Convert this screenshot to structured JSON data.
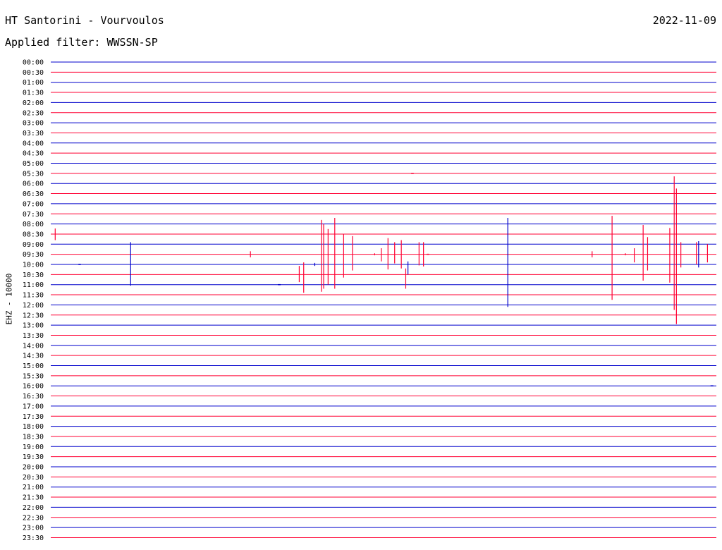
{
  "header": {
    "title": "HT Santorini - Vourvoulos",
    "date": "2022-11-09",
    "filter": "Applied filter: WWSSN-SP"
  },
  "channel_label": "EHZ - 10000",
  "colors": {
    "blue_trace": "#0000cc",
    "red_trace": "#ff0033",
    "background": "#ffffff",
    "text": "#000000"
  },
  "chart_data": {
    "type": "line",
    "subtype": "helicorder",
    "title": "HT Santorini - Vourvoulos",
    "subtitle": "Applied filter: WWSSN-SP",
    "ylabel": "EHZ - 10000",
    "xlim": [
      0,
      30
    ],
    "x_unit": "minutes",
    "row_colors": [
      "blue",
      "red"
    ],
    "rows": [
      "00:00",
      "00:30",
      "01:00",
      "01:30",
      "02:00",
      "02:30",
      "03:00",
      "03:30",
      "04:00",
      "04:30",
      "05:00",
      "05:30",
      "06:00",
      "06:30",
      "07:00",
      "07:30",
      "08:00",
      "08:30",
      "09:00",
      "09:30",
      "10:00",
      "10:30",
      "11:00",
      "11:30",
      "12:00",
      "12:30",
      "13:00",
      "13:30",
      "14:00",
      "14:30",
      "15:00",
      "15:30",
      "16:00",
      "16:30",
      "17:00",
      "17:30",
      "18:00",
      "18:30",
      "19:00",
      "19:30",
      "20:00",
      "20:30",
      "21:00",
      "21:30",
      "22:00",
      "22:30",
      "23:00",
      "23:30"
    ],
    "events": [
      {
        "row": "08:30",
        "minute": 0.2,
        "amp_up": 0.55,
        "amp_down": 0.6
      },
      {
        "row": "10:00",
        "minute": 1.3,
        "amp_up": 0.05,
        "amp_down": 0.05
      },
      {
        "row": "10:00",
        "minute": 3.6,
        "amp_up": 2.2,
        "amp_down": 2.1
      },
      {
        "row": "09:30",
        "minute": 9.0,
        "amp_up": 0.3,
        "amp_down": 0.3
      },
      {
        "row": "11:00",
        "minute": 10.3,
        "amp_up": 0.05,
        "amp_down": 0.05
      },
      {
        "row": "10:30",
        "minute": 11.2,
        "amp_up": 0.85,
        "amp_down": 0.75
      },
      {
        "row": "10:30",
        "minute": 11.4,
        "amp_up": 1.2,
        "amp_down": 1.8
      },
      {
        "row": "10:00",
        "minute": 11.9,
        "amp_up": 0.15,
        "amp_down": 0.15
      },
      {
        "row": "09:30",
        "minute": 12.2,
        "amp_up": 3.4,
        "amp_down": 3.7
      },
      {
        "row": "09:30",
        "minute": 12.3,
        "amp_up": 3.0,
        "amp_down": 3.4
      },
      {
        "row": "09:30",
        "minute": 12.5,
        "amp_up": 2.5,
        "amp_down": 3.0
      },
      {
        "row": "09:30",
        "minute": 12.8,
        "amp_up": 3.6,
        "amp_down": 3.4
      },
      {
        "row": "09:30",
        "minute": 13.2,
        "amp_up": 2.0,
        "amp_down": 2.3
      },
      {
        "row": "09:30",
        "minute": 13.6,
        "amp_up": 1.8,
        "amp_down": 1.6
      },
      {
        "row": "09:30",
        "minute": 14.6,
        "amp_up": 0.1,
        "amp_down": 0.1
      },
      {
        "row": "09:30",
        "minute": 14.9,
        "amp_up": 0.6,
        "amp_down": 0.7
      },
      {
        "row": "09:30",
        "minute": 15.2,
        "amp_up": 1.6,
        "amp_down": 1.5
      },
      {
        "row": "09:30",
        "minute": 15.5,
        "amp_up": 1.2,
        "amp_down": 0.9
      },
      {
        "row": "09:30",
        "minute": 15.8,
        "amp_up": 1.4,
        "amp_down": 1.4
      },
      {
        "row": "10:00",
        "minute": 16.1,
        "amp_up": 0.3,
        "amp_down": 1.0
      },
      {
        "row": "10:30",
        "minute": 16.0,
        "amp_up": 0.6,
        "amp_down": 1.4
      },
      {
        "row": "09:30",
        "minute": 16.6,
        "amp_up": 1.2,
        "amp_down": 1.1
      },
      {
        "row": "09:30",
        "minute": 16.8,
        "amp_up": 1.2,
        "amp_down": 1.2
      },
      {
        "row": "05:30",
        "minute": 16.3,
        "amp_up": 0.05,
        "amp_down": 0.05
      },
      {
        "row": "09:30",
        "minute": 17.0,
        "amp_up": 0.05,
        "amp_down": 0.05
      },
      {
        "row": "10:00",
        "minute": 20.6,
        "amp_up": 4.6,
        "amp_down": 4.2
      },
      {
        "row": "09:30",
        "minute": 24.4,
        "amp_up": 0.3,
        "amp_down": 0.3
      },
      {
        "row": "09:30",
        "minute": 25.3,
        "amp_up": 3.8,
        "amp_down": 4.5
      },
      {
        "row": "09:30",
        "minute": 25.9,
        "amp_up": 0.1,
        "amp_down": 0.1
      },
      {
        "row": "09:30",
        "minute": 26.3,
        "amp_up": 0.6,
        "amp_down": 0.8
      },
      {
        "row": "09:30",
        "minute": 26.7,
        "amp_up": 2.9,
        "amp_down": 2.6
      },
      {
        "row": "09:30",
        "minute": 26.9,
        "amp_up": 1.7,
        "amp_down": 1.6
      },
      {
        "row": "09:30",
        "minute": 27.9,
        "amp_up": 2.6,
        "amp_down": 2.8
      },
      {
        "row": "09:30",
        "minute": 28.1,
        "amp_up": 7.7,
        "amp_down": 5.5
      },
      {
        "row": "09:30",
        "minute": 28.2,
        "amp_up": 6.5,
        "amp_down": 6.9
      },
      {
        "row": "09:30",
        "minute": 28.4,
        "amp_up": 1.2,
        "amp_down": 1.3
      },
      {
        "row": "09:30",
        "minute": 29.1,
        "amp_up": 1.2,
        "amp_down": 1.0
      },
      {
        "row": "10:00",
        "minute": 29.2,
        "amp_up": 2.3,
        "amp_down": 0.3
      },
      {
        "row": "09:30",
        "minute": 29.6,
        "amp_up": 1.0,
        "amp_down": 0.8
      },
      {
        "row": "16:00",
        "minute": 29.8,
        "amp_up": 0.05,
        "amp_down": 0.05
      }
    ]
  }
}
